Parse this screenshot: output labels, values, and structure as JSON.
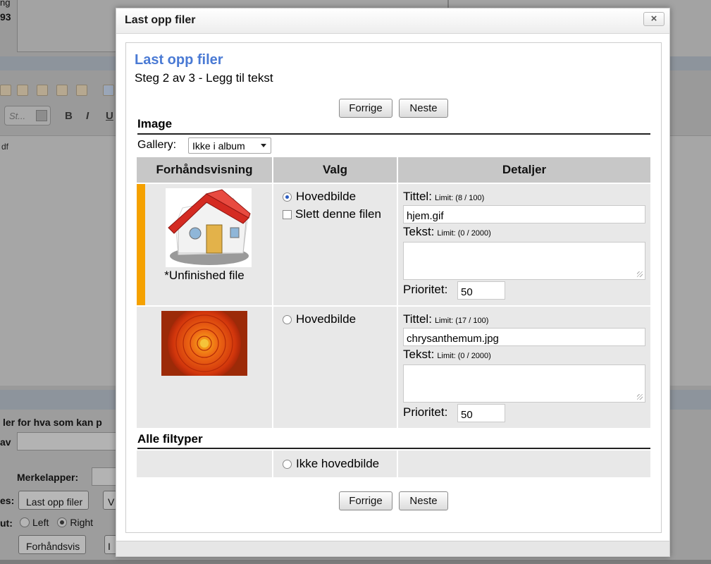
{
  "background": {
    "top_text_1": "ng",
    "top_text_2": "93",
    "style_select": "St...",
    "format_buttons": [
      "B",
      "I",
      "U"
    ],
    "editor_text": "df",
    "hint_text": "ler for hva som kan p",
    "label_av": "av",
    "label_merkelapper": "Merkelapper:",
    "label_es": "es:",
    "upload_button": "Last opp filer",
    "upload_button_2": "V",
    "label_ut": "ut:",
    "radio_left": "Left",
    "radio_right": "Right",
    "preview_button": "Forhåndsvis",
    "preview_button_2": "I"
  },
  "dialog": {
    "title": "Last opp filer",
    "close_label": "×",
    "heading": "Last opp filer",
    "step": "Steg 2 av 3 - Legg til tekst",
    "prev_label": "Forrige",
    "next_label": "Neste",
    "section_image": "Image",
    "gallery_label": "Gallery:",
    "gallery_value": "Ikke i album",
    "columns": [
      "Forhåndsvisning",
      "Valg",
      "Detaljer"
    ],
    "files": [
      {
        "caption": "*Unfinished file",
        "main_image_label": "Hovedbilde",
        "main_image_selected": true,
        "delete_label": "Slett denne filen",
        "title_label": "Tittel:",
        "title_limit": "Limit: (8 / 100)",
        "title_value": "hjem.gif",
        "text_label": "Tekst:",
        "text_limit": "Limit: (0 / 2000)",
        "text_value": "",
        "priority_label": "Prioritet:",
        "priority_value": "50"
      },
      {
        "caption": "",
        "main_image_label": "Hovedbilde",
        "main_image_selected": false,
        "title_label": "Tittel:",
        "title_limit": "Limit: (17 / 100)",
        "title_value": "chrysanthemum.jpg",
        "text_label": "Tekst:",
        "text_limit": "Limit: (0 / 2000)",
        "text_value": "",
        "priority_label": "Prioritet:",
        "priority_value": "50"
      }
    ],
    "section_all": "Alle filtyper",
    "no_main_image_label": "Ikke hovedbilde"
  },
  "colors": {
    "heading": "#4a7ad4",
    "accent": "#f5a100",
    "header_cell": "#c7c7c7",
    "row_cell": "#e8e8e8"
  }
}
